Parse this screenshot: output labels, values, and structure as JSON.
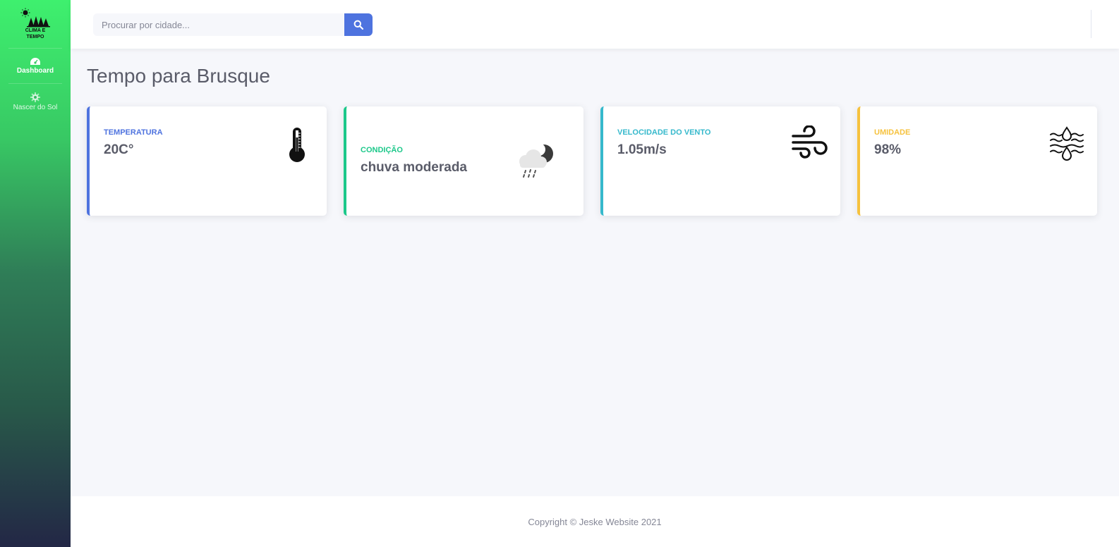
{
  "sidebar": {
    "brand_line1": "CLIMA E",
    "brand_line2": "TEMPO",
    "items": [
      {
        "label": "Dashboard",
        "icon": "tachometer-icon"
      },
      {
        "label": "Nascer do Sol",
        "icon": "cog-icon"
      }
    ]
  },
  "search": {
    "placeholder": "Procurar por cidade...",
    "value": "",
    "icon": "search-icon"
  },
  "page": {
    "title": "Tempo para Brusque"
  },
  "cards": [
    {
      "label": "TEMPERATURA",
      "value": "20C°",
      "icon": "thermometer-icon",
      "accent": "#4e73df"
    },
    {
      "label": "CONDIÇÃO",
      "value": "chuva moderada",
      "icon": "rain-cloud-moon-icon",
      "accent": "#1cc88a"
    },
    {
      "label": "VELOCIDADE DO VENTO",
      "value": "1.05m/s",
      "icon": "wind-icon",
      "accent": "#36b9cc"
    },
    {
      "label": "UMIDADE",
      "value": "98%",
      "icon": "humidity-icon",
      "accent": "#f6c23e"
    }
  ],
  "footer": {
    "copyright": "Copyright © Jeske Website 2021"
  }
}
